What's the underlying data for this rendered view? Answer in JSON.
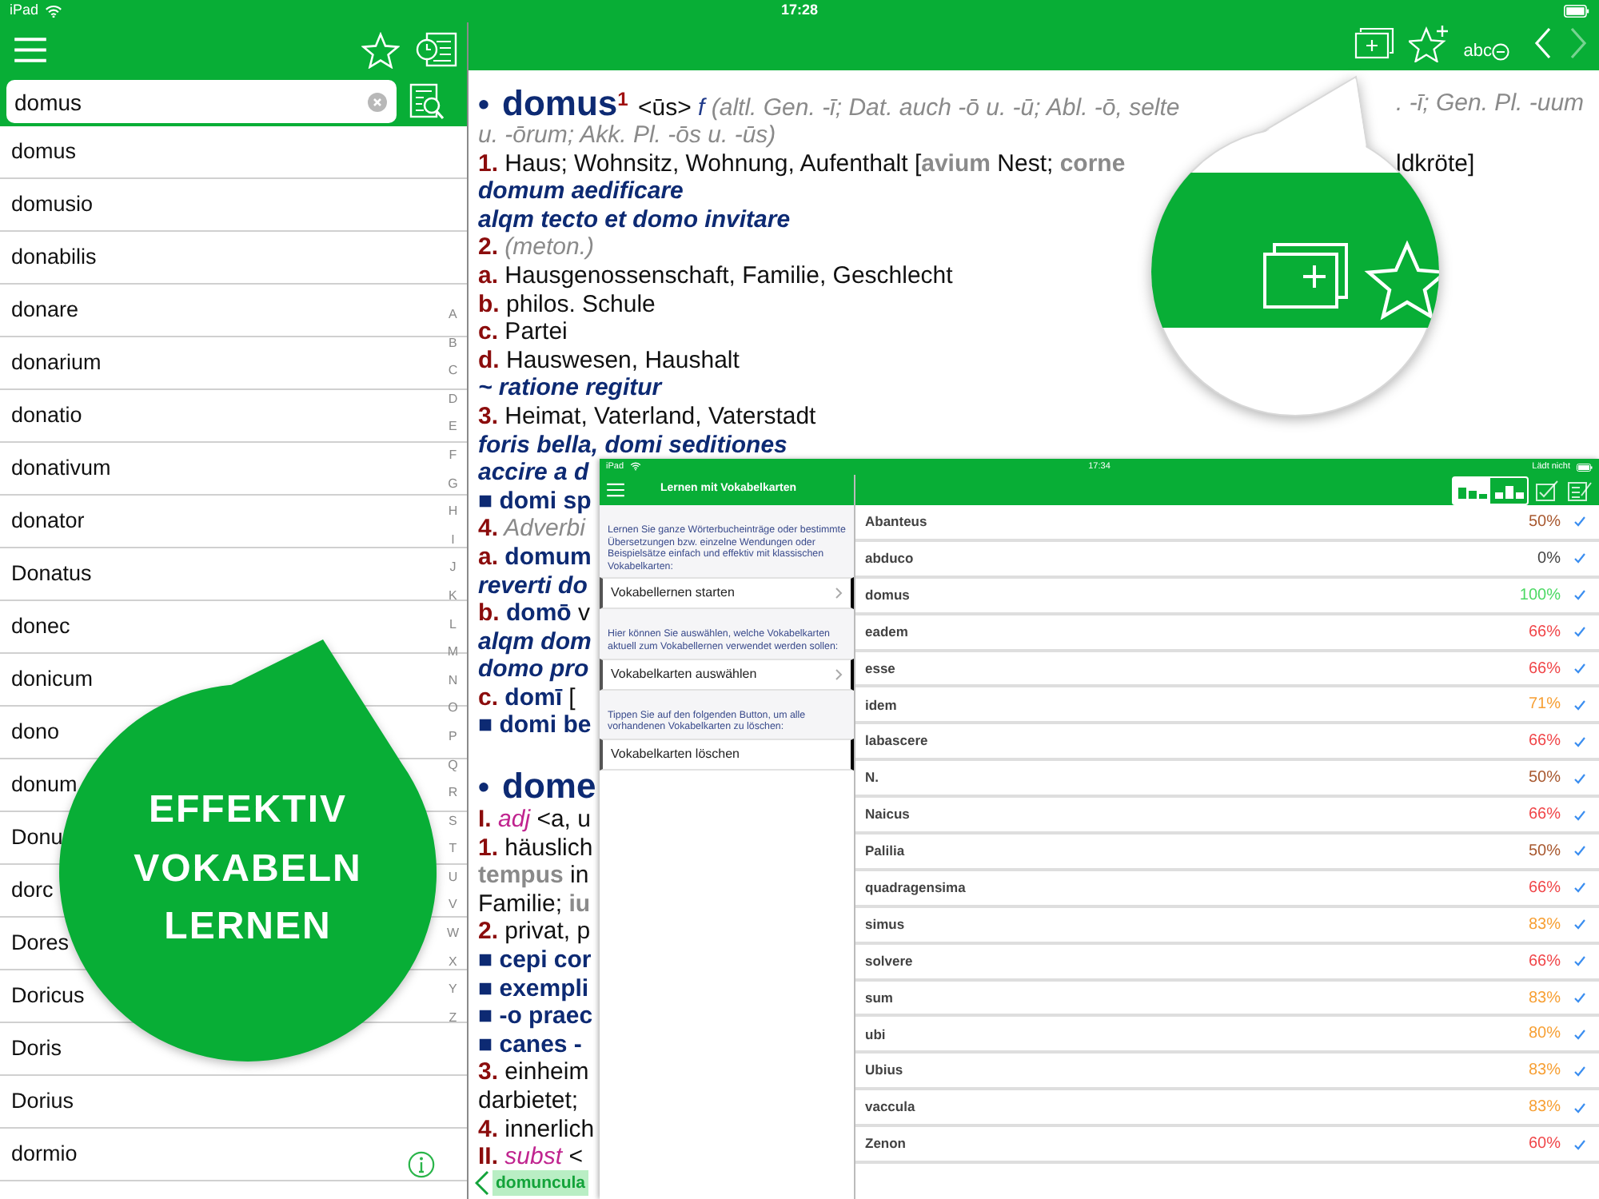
{
  "status_bar": {
    "carrier": "iPad",
    "time": "17:28"
  },
  "sidebar": {
    "search": {
      "value": "domus"
    },
    "items": [
      {
        "label": "domus"
      },
      {
        "label": "domusio"
      },
      {
        "label": "donabilis"
      },
      {
        "label": "donare"
      },
      {
        "label": "donarium"
      },
      {
        "label": "donatio"
      },
      {
        "label": "donativum"
      },
      {
        "label": "donator"
      },
      {
        "label": "Donatus"
      },
      {
        "label": "donec"
      },
      {
        "label": "donicum"
      },
      {
        "label": "dono"
      },
      {
        "label": "donum"
      },
      {
        "label": "Donu"
      },
      {
        "label": "dorc"
      },
      {
        "label": "Dores"
      },
      {
        "label": "Doricus"
      },
      {
        "label": "Doris"
      },
      {
        "label": "Dorius"
      },
      {
        "label": "dormio"
      }
    ],
    "index": [
      "A",
      "B",
      "C",
      "D",
      "E",
      "F",
      "G",
      "H",
      "I",
      "J",
      "K",
      "L",
      "M",
      "N",
      "O",
      "P",
      "Q",
      "R",
      "S",
      "T",
      "U",
      "V",
      "W",
      "X",
      "Y",
      "Z"
    ]
  },
  "toolbar": [
    {
      "kind": "card-add",
      "disabled": false
    },
    {
      "kind": "star-add",
      "disabled": false
    },
    {
      "kind": "abc",
      "label": "abc",
      "disabled": false
    },
    {
      "kind": "back",
      "disabled": false
    },
    {
      "kind": "forward",
      "disabled": true
    }
  ],
  "entry": {
    "lines": [
      {
        "kind": "headline",
        "segments": [
          {
            "kind": "bullet",
            "text": "•"
          },
          {
            "kind": "headword",
            "text": "domus"
          },
          {
            "kind": "homonym",
            "text": "1"
          },
          {
            "kind": "text",
            "text": " <ūs> "
          },
          {
            "kind": "gender",
            "text": "f"
          },
          {
            "kind": "gram",
            "text": " (altl. Gen. -ī; Dat. auch -ō u. -ū; Abl. -ō, selte"
          }
        ],
        "tail": [
          {
            "kind": "gram",
            "text": ". -ī; Gen. Pl. -uum"
          }
        ]
      },
      {
        "kind": "line",
        "segments": [
          {
            "kind": "gram",
            "text": "u. -ōrum; Akk. Pl. -ōs u. -ūs)"
          }
        ]
      },
      {
        "kind": "line",
        "segments": [
          {
            "kind": "num",
            "text": "1."
          },
          {
            "kind": "text",
            "text": " Haus; Wohnsitz, Wohnung, Aufenthalt ["
          },
          {
            "kind": "quote",
            "text": "avium"
          },
          {
            "kind": "text",
            "text": " Nest; "
          },
          {
            "kind": "quote",
            "text": "corne"
          }
        ],
        "tail": [
          {
            "kind": "text",
            "text": "ldkröte]"
          }
        ]
      },
      {
        "kind": "line",
        "segments": [
          {
            "kind": "latin",
            "text": "domum aedificare"
          }
        ]
      },
      {
        "kind": "line",
        "segments": [
          {
            "kind": "latin",
            "text": "alqm tecto et domo invitare"
          }
        ]
      },
      {
        "kind": "line",
        "segments": [
          {
            "kind": "num",
            "text": "2."
          },
          {
            "kind": "gram",
            "text": " (meton.)"
          }
        ]
      },
      {
        "kind": "line",
        "segments": [
          {
            "kind": "num",
            "text": "a."
          },
          {
            "kind": "text",
            "text": " Hausgenossenschaft, Familie, Geschlecht"
          }
        ]
      },
      {
        "kind": "line",
        "segments": [
          {
            "kind": "num",
            "text": "b."
          },
          {
            "kind": "text",
            "text": " philos. Schule"
          }
        ]
      },
      {
        "kind": "line",
        "segments": [
          {
            "kind": "num",
            "text": "c."
          },
          {
            "kind": "text",
            "text": " Partei"
          }
        ]
      },
      {
        "kind": "line",
        "segments": [
          {
            "kind": "num",
            "text": "d."
          },
          {
            "kind": "text",
            "text": " Hauswesen, Haushalt"
          }
        ]
      },
      {
        "kind": "line",
        "segments": [
          {
            "kind": "latin",
            "text": "~ ratione regitur"
          }
        ]
      },
      {
        "kind": "line",
        "segments": [
          {
            "kind": "num",
            "text": "3."
          },
          {
            "kind": "text",
            "text": " Heimat, Vaterland, Vaterstadt"
          }
        ]
      },
      {
        "kind": "line",
        "segments": [
          {
            "kind": "latin",
            "text": "foris bella, domi seditiones"
          }
        ]
      },
      {
        "kind": "line",
        "segments": [
          {
            "kind": "latin",
            "text": "accire a d"
          }
        ]
      },
      {
        "kind": "line",
        "segments": [
          {
            "kind": "phrase",
            "text": "■ domi sp"
          }
        ]
      },
      {
        "kind": "line",
        "segments": [
          {
            "kind": "num",
            "text": "4."
          },
          {
            "kind": "gram",
            "text": " Adverbi"
          }
        ]
      },
      {
        "kind": "line",
        "segments": [
          {
            "kind": "num",
            "text": "a."
          },
          {
            "kind": "phrase",
            "text": " domum"
          }
        ]
      },
      {
        "kind": "line",
        "segments": [
          {
            "kind": "latin",
            "text": "reverti do"
          }
        ]
      },
      {
        "kind": "line",
        "segments": [
          {
            "kind": "num",
            "text": "b."
          },
          {
            "kind": "phrase",
            "text": " domō"
          },
          {
            "kind": "text",
            "text": " v"
          }
        ]
      },
      {
        "kind": "line",
        "segments": [
          {
            "kind": "latin",
            "text": "alqm dom"
          }
        ]
      },
      {
        "kind": "line",
        "segments": [
          {
            "kind": "latin",
            "text": "domo pro"
          }
        ]
      },
      {
        "kind": "line",
        "segments": [
          {
            "kind": "num",
            "text": "c."
          },
          {
            "kind": "phrase",
            "text": " domī"
          },
          {
            "kind": "text",
            "text": " ["
          }
        ]
      },
      {
        "kind": "line",
        "segments": [
          {
            "kind": "phrase",
            "text": "■ domi be"
          }
        ]
      },
      {
        "kind": "headline2",
        "segments": [
          {
            "kind": "bullet",
            "text": "•"
          },
          {
            "kind": "headword",
            "text": "dome"
          }
        ]
      },
      {
        "kind": "line",
        "segments": [
          {
            "kind": "num",
            "text": "I."
          },
          {
            "kind": "wordclass",
            "text": " adj"
          },
          {
            "kind": "text",
            "text": " <a, u"
          }
        ]
      },
      {
        "kind": "line",
        "segments": [
          {
            "kind": "num",
            "text": "1."
          },
          {
            "kind": "text",
            "text": " häuslich"
          }
        ]
      },
      {
        "kind": "line",
        "segments": [
          {
            "kind": "quote",
            "text": "tempus"
          },
          {
            "kind": "text",
            "text": " in"
          }
        ]
      },
      {
        "kind": "line",
        "segments": [
          {
            "kind": "text",
            "text": "Familie; "
          },
          {
            "kind": "quote",
            "text": "iu"
          }
        ]
      },
      {
        "kind": "line",
        "segments": [
          {
            "kind": "num",
            "text": "2."
          },
          {
            "kind": "text",
            "text": " privat, p"
          }
        ]
      },
      {
        "kind": "line",
        "segments": [
          {
            "kind": "phrase",
            "text": "■ cepi cor"
          }
        ]
      },
      {
        "kind": "line",
        "segments": [
          {
            "kind": "phrase",
            "text": "■ exempli"
          }
        ]
      },
      {
        "kind": "line",
        "segments": [
          {
            "kind": "phrase",
            "text": "■ -o praec"
          }
        ]
      },
      {
        "kind": "line",
        "segments": [
          {
            "kind": "phrase",
            "text": "■ canes -"
          }
        ]
      },
      {
        "kind": "line",
        "segments": [
          {
            "kind": "num",
            "text": "3."
          },
          {
            "kind": "text",
            "text": " einheim"
          }
        ]
      },
      {
        "kind": "line",
        "segments": [
          {
            "kind": "text",
            "text": "darbietet;"
          }
        ]
      },
      {
        "kind": "line",
        "segments": [
          {
            "kind": "num",
            "text": "4."
          },
          {
            "kind": "text",
            "text": " innerlich"
          }
        ]
      },
      {
        "kind": "line",
        "segments": [
          {
            "kind": "num",
            "text": "II."
          },
          {
            "kind": "wordclass",
            "text": " subst"
          },
          {
            "kind": "text",
            "text": " <"
          }
        ]
      }
    ],
    "back_link": "domuncula"
  },
  "callout": {
    "lines": [
      "EFFEKTIV",
      "VOKABELN",
      "LERNEN"
    ]
  },
  "inset": {
    "status": {
      "carrier": "iPad",
      "time": "17:34",
      "charge_text": "Lädt nicht"
    },
    "title": "Lernen mit Vokabelkarten",
    "menu": [
      {
        "kind": "note",
        "text": "Lernen Sie ganze Wörterbucheinträge oder bestimmte Übersetzungen bzw. einzelne Wendungen oder Beispielsätze einfach und effektiv mit klassischen Vokabelkarten:"
      },
      {
        "kind": "row",
        "label": "Vokabellernen starten",
        "chevron": true
      },
      {
        "kind": "note",
        "text": "Hier können Sie auswählen, welche Vokabelkarten aktuell zum Vokabellernen verwendet werden sollen:"
      },
      {
        "kind": "row",
        "label": "Vokabelkarten auswählen",
        "chevron": true
      },
      {
        "kind": "note",
        "text": "Tippen Sie auf den folgenden Button, um alle vorhandenen Vokabelkarten zu löschen:"
      },
      {
        "kind": "row",
        "label": "Vokabelkarten löschen",
        "chevron": false
      }
    ],
    "sort": [
      {
        "kind": "alpha",
        "selected": true
      },
      {
        "kind": "score",
        "selected": false
      }
    ],
    "cards": [
      {
        "word": "Abanteus",
        "score": "50%",
        "color": "#a8582f",
        "checked": true
      },
      {
        "word": "abduco",
        "score": "0%",
        "color": "#444444",
        "checked": true
      },
      {
        "word": "domus",
        "score": "100%",
        "color": "#4cd964",
        "checked": true
      },
      {
        "word": "eadem",
        "score": "66%",
        "color": "#f0474a",
        "checked": true
      },
      {
        "word": "esse",
        "score": "66%",
        "color": "#f0474a",
        "checked": true
      },
      {
        "word": "idem",
        "score": "71%",
        "color": "#f7a035",
        "checked": true
      },
      {
        "word": "labascere",
        "score": "66%",
        "color": "#f0474a",
        "checked": true
      },
      {
        "word": "N.",
        "score": "50%",
        "color": "#a8582f",
        "checked": true
      },
      {
        "word": "Naicus",
        "score": "66%",
        "color": "#f0474a",
        "checked": true
      },
      {
        "word": "Palilia",
        "score": "50%",
        "color": "#a8582f",
        "checked": true
      },
      {
        "word": "quadragensima",
        "score": "66%",
        "color": "#f0474a",
        "checked": true
      },
      {
        "word": "simus",
        "score": "83%",
        "color": "#f7a035",
        "checked": true
      },
      {
        "word": "solvere",
        "score": "66%",
        "color": "#f0474a",
        "checked": true
      },
      {
        "word": "sum",
        "score": "83%",
        "color": "#f7a035",
        "checked": true
      },
      {
        "word": "ubi",
        "score": "80%",
        "color": "#f7a035",
        "checked": true
      },
      {
        "word": "Ubius",
        "score": "83%",
        "color": "#f7a035",
        "checked": true
      },
      {
        "word": "vaccula",
        "score": "83%",
        "color": "#f7a035",
        "checked": true
      },
      {
        "word": "Zenon",
        "score": "60%",
        "color": "#f0474a",
        "checked": true
      }
    ]
  }
}
